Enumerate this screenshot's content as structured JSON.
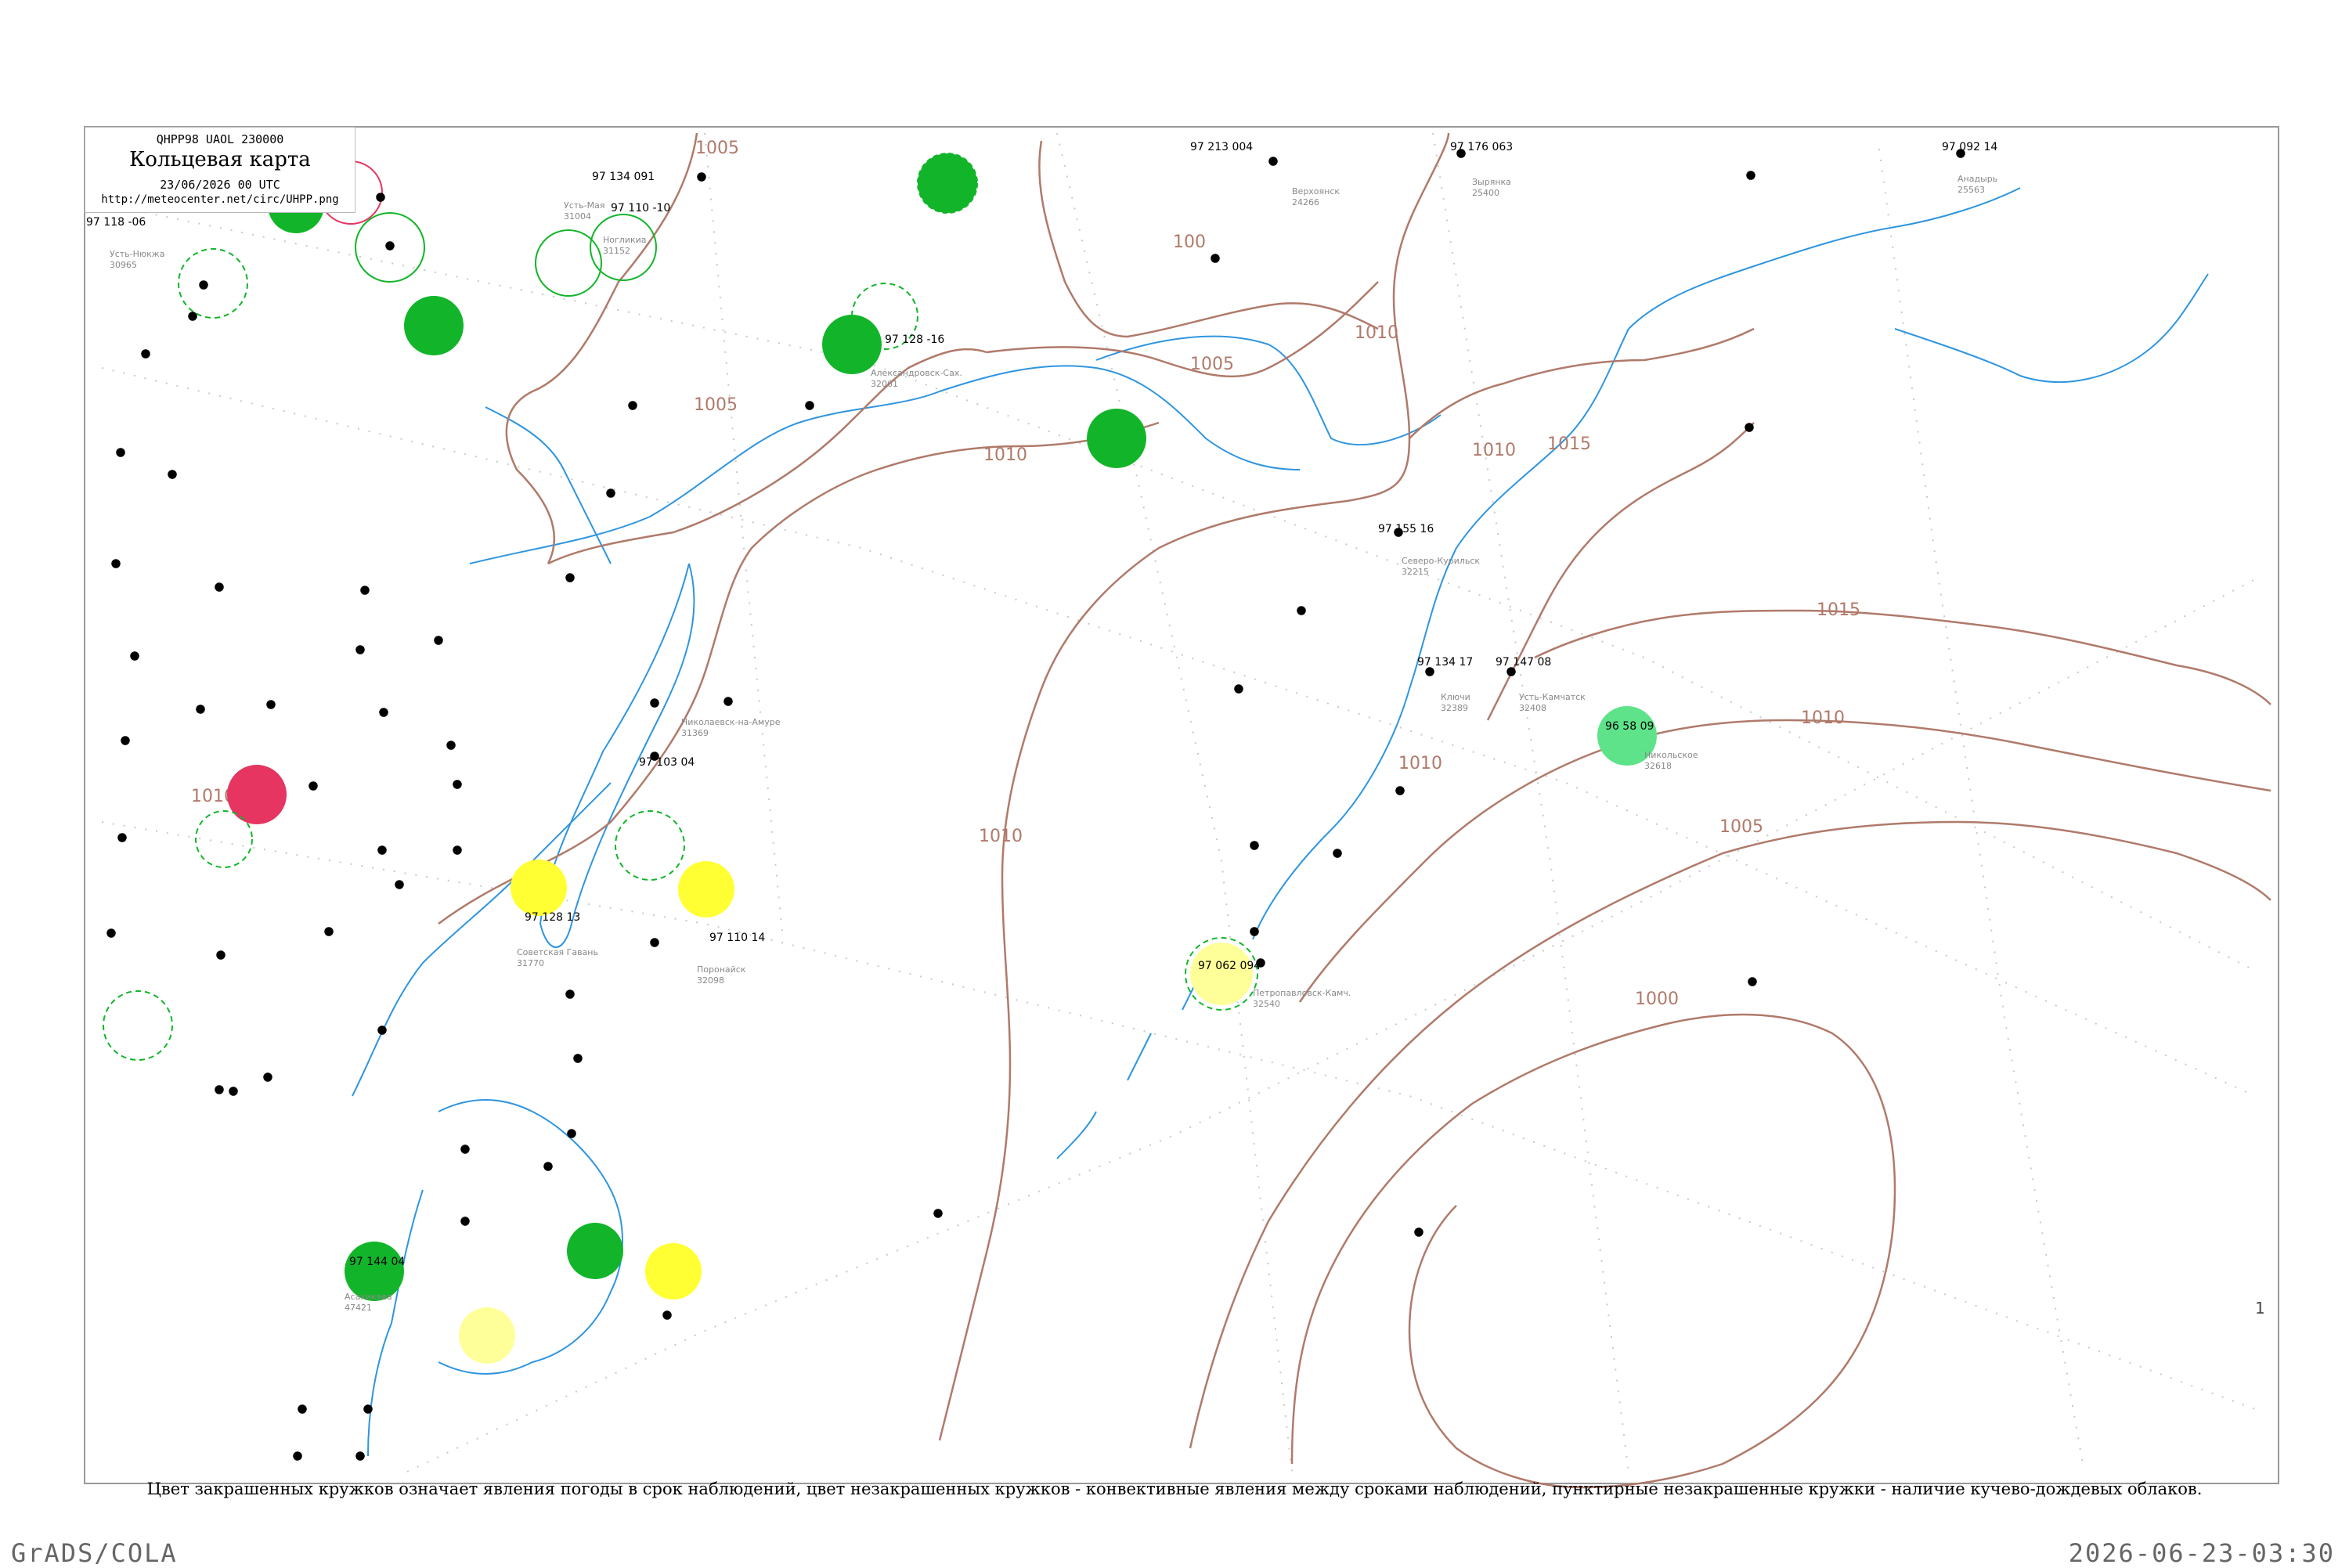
{
  "header": {
    "code": "QHPP98  UAOL  230000",
    "title": "Кольцевая карта",
    "date": "23/06/2026 00 UTC",
    "url": "http://meteocenter.net/circ/UHPP.png"
  },
  "caption": "Цвет закрашенных кружков означает явления погоды в срок наблюдений, цвет незакрашенных кружков - конвективные явления между сроками наблюдений, пунктирные незакрашенные кружки - наличие кучево-дождевых облаков.",
  "footer": {
    "left": "GrADS/COLA",
    "right": "2026-06-23-03:30"
  },
  "colors": {
    "isobar": "#b07a6a",
    "coast": "#2f95e0",
    "green": "#12b52a",
    "light_green": "#5ee38a",
    "yellow": "#ffff33",
    "pale_yellow": "#ffff99",
    "red": "#e53560",
    "station": "#000000",
    "station_name": "#888888"
  },
  "isobars": [
    "1005",
    "1010",
    "1015",
    "1000"
  ],
  "isobar_labels": [
    {
      "value": "1005"
    },
    {
      "value": "1005"
    },
    {
      "value": "1005"
    },
    {
      "value": "1010"
    },
    {
      "value": "1010"
    },
    {
      "value": "1010"
    },
    {
      "value": "1015"
    },
    {
      "value": "1015"
    },
    {
      "value": "1010"
    },
    {
      "value": "1010"
    },
    {
      "value": "1005"
    },
    {
      "value": "1000"
    },
    {
      "value": "1010"
    },
    {
      "value": "1010"
    },
    {
      "value": "100"
    }
  ],
  "stations": [
    {
      "id": "31152",
      "name": "Ногликиа",
      "t": "97",
      "p": "110",
      "d": "-10"
    },
    {
      "id": "30965",
      "name": "Усть-Нюкжа",
      "t": "97",
      "p": "118",
      "d": "-06"
    },
    {
      "id": "31004",
      "name": "Усть-Мая",
      "t": "97",
      "p": "134",
      "d": "091"
    },
    {
      "id": "32389",
      "name": "Ключи",
      "t": "97",
      "p": "134",
      "d": "17"
    },
    {
      "id": "32098",
      "name": "Поронайск",
      "t": "97",
      "p": "110",
      "d": "14"
    },
    {
      "id": "47421",
      "name": "Асахикава",
      "t": "97",
      "p": "144",
      "d": "04"
    },
    {
      "id": "32540",
      "name": "Петропавловск-Камч.",
      "t": "97",
      "p": "062",
      "d": "094"
    },
    {
      "id": "31369",
      "name": "Николаевск-на-Амуре",
      "t": "97",
      "p": "103",
      "d": "04"
    },
    {
      "id": "32618",
      "name": "Никольское",
      "t": "96",
      "p": "58",
      "d": "09"
    },
    {
      "id": "32061",
      "name": "Александровск-Сах.",
      "t": "97",
      "p": "128",
      "d": "-16"
    },
    {
      "id": "31770",
      "name": "Советская Гавань",
      "t": "97",
      "p": "128",
      "d": "13"
    },
    {
      "id": "32215",
      "name": "Северо-Курильск",
      "t": "97",
      "p": "155",
      "d": "16"
    },
    {
      "id": "32408",
      "name": "Усть-Камчатск",
      "t": "97",
      "p": "147",
      "d": "08"
    },
    {
      "id": "25563",
      "name": "Анадырь",
      "t": "97",
      "p": "092",
      "d": "14"
    },
    {
      "id": "25400",
      "name": "Зырянка",
      "t": "97",
      "p": "176",
      "d": "063"
    },
    {
      "id": "24266",
      "name": "Верхоянск",
      "t": "97",
      "p": "213",
      "d": "004"
    }
  ],
  "weather_circles": [
    {
      "type": "filled",
      "color": "green"
    },
    {
      "type": "filled",
      "color": "green"
    },
    {
      "type": "filled",
      "color": "green"
    },
    {
      "type": "filled",
      "color": "green"
    },
    {
      "type": "filled",
      "color": "green"
    },
    {
      "type": "filled",
      "color": "green"
    },
    {
      "type": "filled",
      "color": "green"
    },
    {
      "type": "filled",
      "color": "light_green"
    },
    {
      "type": "filled",
      "color": "red"
    },
    {
      "type": "filled",
      "color": "yellow"
    },
    {
      "type": "filled",
      "color": "yellow"
    },
    {
      "type": "filled",
      "color": "yellow"
    },
    {
      "type": "filled",
      "color": "pale_yellow"
    },
    {
      "type": "filled",
      "color": "pale_yellow"
    },
    {
      "type": "dashed",
      "color": "green"
    },
    {
      "type": "dashed",
      "color": "green"
    },
    {
      "type": "dashed",
      "color": "green"
    },
    {
      "type": "dashed",
      "color": "green"
    },
    {
      "type": "dashed",
      "color": "green"
    },
    {
      "type": "open",
      "color": "green"
    },
    {
      "type": "open",
      "color": "green"
    },
    {
      "type": "open",
      "color": "red"
    }
  ],
  "corner_mark": "1"
}
